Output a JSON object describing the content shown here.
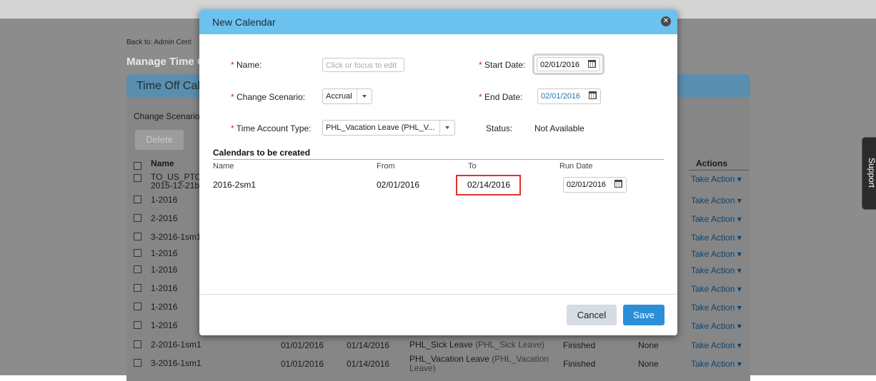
{
  "background": {
    "back_link": "Back to: Admin Cent",
    "page_title": "Manage Time C",
    "panel_title": "Time Off Cale",
    "change_scenario_label": "Change Scenario:",
    "delete_label": "Delete",
    "columns": {
      "name": "Name",
      "actions": "Actions"
    },
    "rows": [
      {
        "name_line1": "TO_US_PTO",
        "name_line2": "2015-12-21b",
        "from": "",
        "to": "",
        "type": "",
        "type_code": "",
        "status": "",
        "calendar": "",
        "action": "Take Action"
      },
      {
        "name_line1": "1-2016",
        "name_line2": "",
        "from": "",
        "to": "",
        "type": "",
        "type_code": "",
        "status": "",
        "calendar": "",
        "action": "Take Action"
      },
      {
        "name_line1": "2-2016",
        "name_line2": "",
        "from": "",
        "to": "",
        "type": "",
        "type_code": "",
        "status": "",
        "calendar": "",
        "action": "Take Action"
      },
      {
        "name_line1": "3-2016-1sm1",
        "name_line2": "",
        "from": "",
        "to": "",
        "type": "",
        "type_code": "",
        "status": "",
        "calendar": "",
        "action": "Take Action"
      },
      {
        "name_line1": "1-2016",
        "name_line2": "",
        "from": "",
        "to": "",
        "type": "",
        "type_code": "",
        "status": "",
        "calendar": "",
        "action": "Take Action"
      },
      {
        "name_line1": "1-2016",
        "name_line2": "",
        "from": "",
        "to": "",
        "type": "",
        "type_code": "",
        "status": "",
        "calendar": "",
        "action": "Take Action"
      },
      {
        "name_line1": "1-2016",
        "name_line2": "",
        "from": "",
        "to": "",
        "type": "",
        "type_code": "",
        "status": "",
        "calendar": "",
        "action": "Take Action"
      },
      {
        "name_line1": "1-2016",
        "name_line2": "",
        "from": "",
        "to": "",
        "type": "",
        "type_code": "",
        "status": "",
        "calendar": "",
        "action": "Take Action"
      },
      {
        "name_line1": "1-2016",
        "name_line2": "",
        "from": "",
        "to": "",
        "type": "",
        "type_code": "",
        "status": "",
        "calendar": "",
        "action": "Take Action"
      },
      {
        "name_line1": "2-2016-1sm1",
        "name_line2": "",
        "from": "01/01/2016",
        "to": "01/14/2016",
        "type": "PHL_Sick Leave",
        "type_code": "(PHL_Sick Leave)",
        "status": "Finished",
        "calendar": "None",
        "action": "Take Action"
      },
      {
        "name_line1": "3-2016-1sm1",
        "name_line2": "",
        "from": "01/01/2016",
        "to": "01/14/2016",
        "type": "PHL_Vacation Leave",
        "type_code": "(PHL_Vacation Leave)",
        "status": "Finished",
        "calendar": "None",
        "action": "Take Action"
      }
    ],
    "support_label": "Support"
  },
  "modal": {
    "title": "New Calendar",
    "name_label": "Name:",
    "name_placeholder": "Click or focus to edit",
    "change_scenario_label": "Change Scenario:",
    "change_scenario_value": "Accrual",
    "time_account_type_label": "Time Account Type:",
    "time_account_type_value": "PHL_Vacation Leave (PHL_V...",
    "start_date_label": "Start Date:",
    "start_date_value": "02/01/2016",
    "end_date_label": "End Date:",
    "end_date_value": "02/01/2016",
    "status_label": "Status:",
    "status_value": "Not Available",
    "section_title": "Calendars to be created",
    "table": {
      "headers": {
        "name": "Name",
        "from": "From",
        "to": "To",
        "run_date": "Run Date"
      },
      "row": {
        "name": "2016-2sm1",
        "from": "02/01/2016",
        "to": "02/14/2016",
        "run_date": "02/01/2016"
      }
    },
    "cancel_label": "Cancel",
    "save_label": "Save"
  },
  "colors": {
    "modal_header": "#6cc2ef",
    "save_button": "#2b8fd8",
    "required_marker": "#d9230f",
    "highlight_box": "#e0332b"
  }
}
